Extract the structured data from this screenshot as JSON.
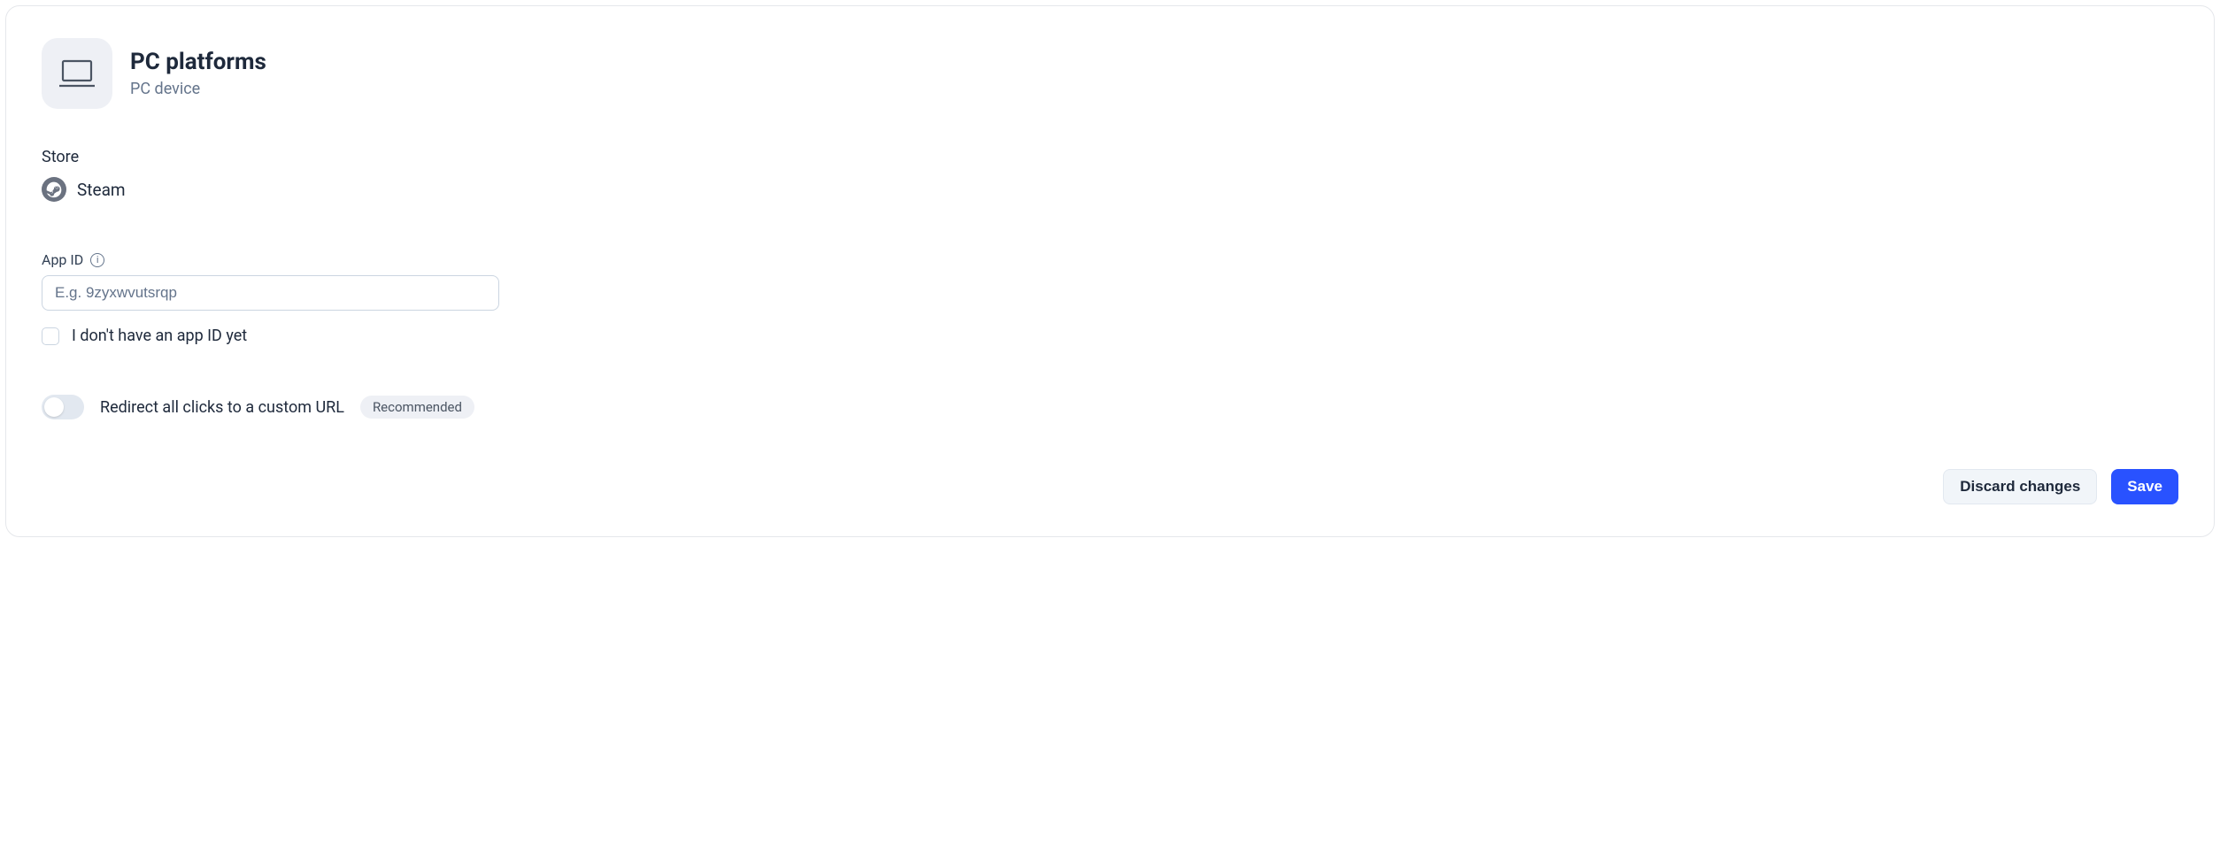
{
  "header": {
    "title": "PC platforms",
    "subtitle": "PC device"
  },
  "store": {
    "section_label": "Store",
    "name": "Steam"
  },
  "app_id": {
    "label": "App ID",
    "placeholder": "E.g. 9zyxwvutsrqp",
    "value": "",
    "checkbox_label": "I don't have an app ID yet"
  },
  "redirect": {
    "label": "Redirect all clicks to a custom URL",
    "badge": "Recommended"
  },
  "footer": {
    "discard_label": "Discard changes",
    "save_label": "Save"
  }
}
